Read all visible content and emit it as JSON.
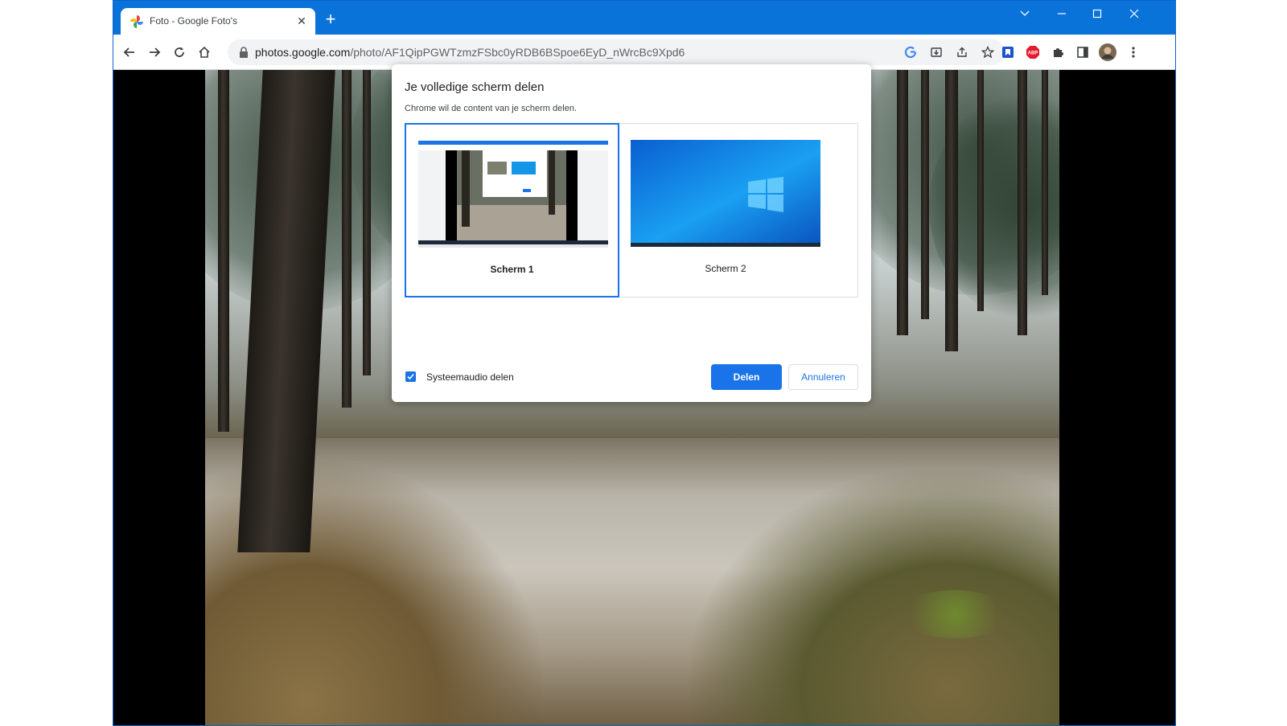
{
  "browser": {
    "tab_title": "Foto - Google Foto's",
    "url_domain": "photos.google.com",
    "url_path": "/photo/AF1QipPGWTzmzFSbc0yRDB6BSpoe6EyD_nWrcBc9Xpd6",
    "extension_abp_label": "ABP",
    "accent_color": "#0a73d9"
  },
  "dialog": {
    "title": "Je volledige scherm delen",
    "subtitle": "Chrome wil de content van je scherm delen.",
    "sources": [
      {
        "label": "Scherm 1",
        "selected": true
      },
      {
        "label": "Scherm 2",
        "selected": false
      }
    ],
    "audio_checkbox_label": "Systeemaudio delen",
    "audio_checked": true,
    "share_button": "Delen",
    "cancel_button": "Annuleren",
    "primary_color": "#1a73e8"
  }
}
